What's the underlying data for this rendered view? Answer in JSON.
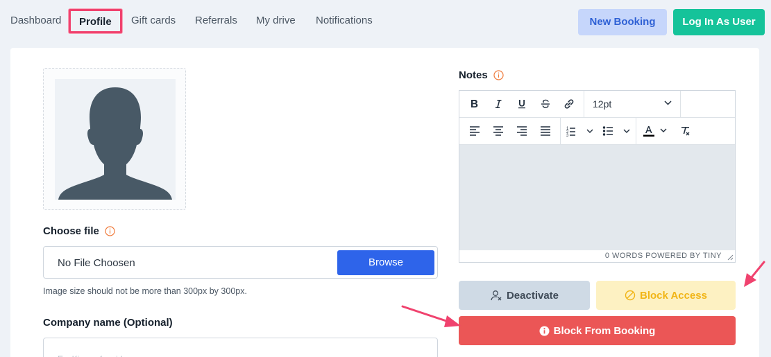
{
  "nav": {
    "items": [
      {
        "label": "Dashboard"
      },
      {
        "label": "Profile"
      },
      {
        "label": "Gift cards"
      },
      {
        "label": "Referrals"
      },
      {
        "label": "My drive"
      },
      {
        "label": "Notifications"
      }
    ],
    "new_booking_label": "New Booking",
    "login_as_user_label": "Log In As User"
  },
  "profile": {
    "choose_file_label": "Choose file",
    "file_value": "No File Choosen",
    "browse_label": "Browse",
    "image_hint": "Image size should not be more than 300px by 300px.",
    "company_label": "Company name (Optional)",
    "company_placeholder": "Ex: Kings of maids"
  },
  "notes": {
    "label": "Notes",
    "font_size": "12pt",
    "status": "0 WORDS  POWERED BY TINY"
  },
  "actions": {
    "deactivate_label": "Deactivate",
    "block_access_label": "Block Access",
    "block_booking_label": "Block From Booking"
  },
  "colors": {
    "accent_blue": "#2e64ea",
    "login_green": "#15c39a",
    "highlight_pink": "#f0426e",
    "block_yellow": "#f1b517",
    "danger_red": "#eb5656",
    "info_orange": "#f07a3a"
  }
}
